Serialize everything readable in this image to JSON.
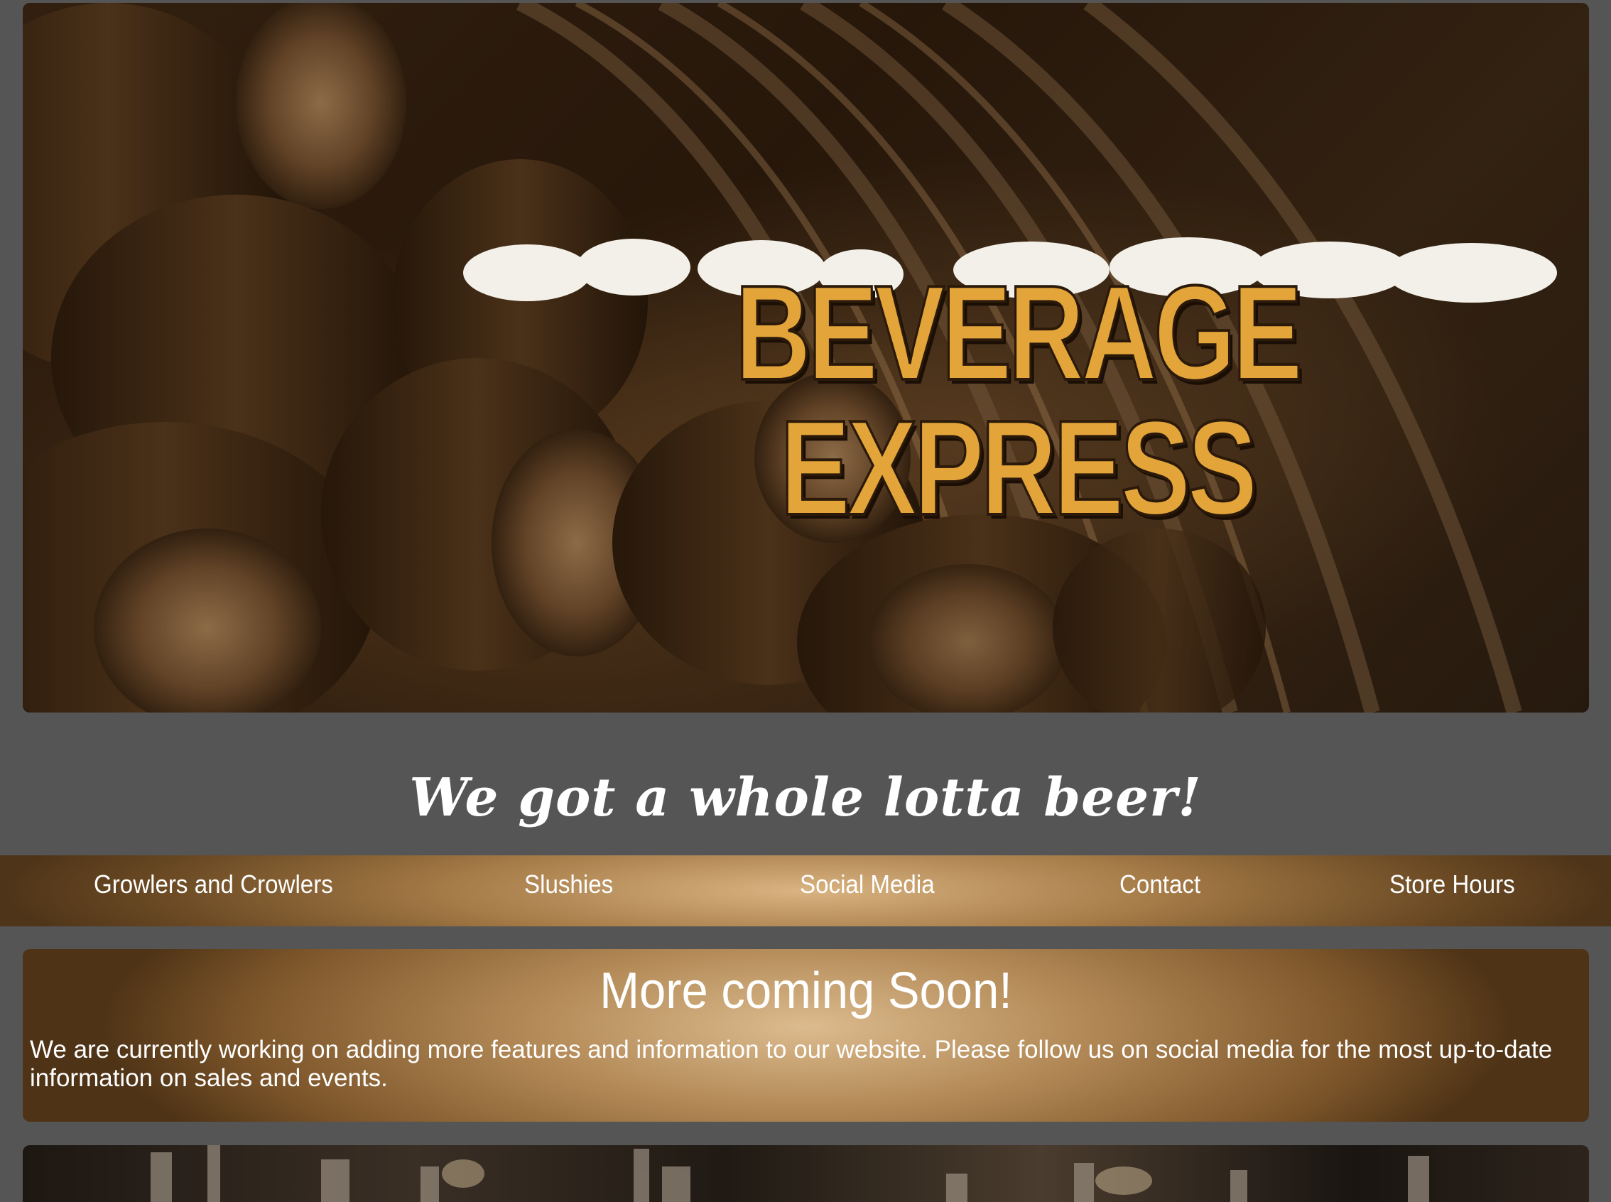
{
  "hero": {
    "logo_text": "BEVERAGE EXPRESS",
    "image": "barrels-photo"
  },
  "tagline": "We got a whole lotta beer!",
  "nav": {
    "items": [
      {
        "label": "Growlers and Crowlers"
      },
      {
        "label": "Slushies"
      },
      {
        "label": "Social Media"
      },
      {
        "label": "Contact"
      },
      {
        "label": "Store Hours"
      }
    ]
  },
  "card": {
    "title": "More coming Soon!",
    "body": "We are currently working on adding more features and information to our website. Please follow us on social media for the most up-to-date information on sales and events."
  },
  "bottom": {
    "image": "beer-taps-photo"
  },
  "colors": {
    "page_bg": "#555556",
    "logo_gold": "#e3a43a",
    "nav_gradient_center": "#d9b381",
    "nav_gradient_edge": "#4e3418"
  }
}
